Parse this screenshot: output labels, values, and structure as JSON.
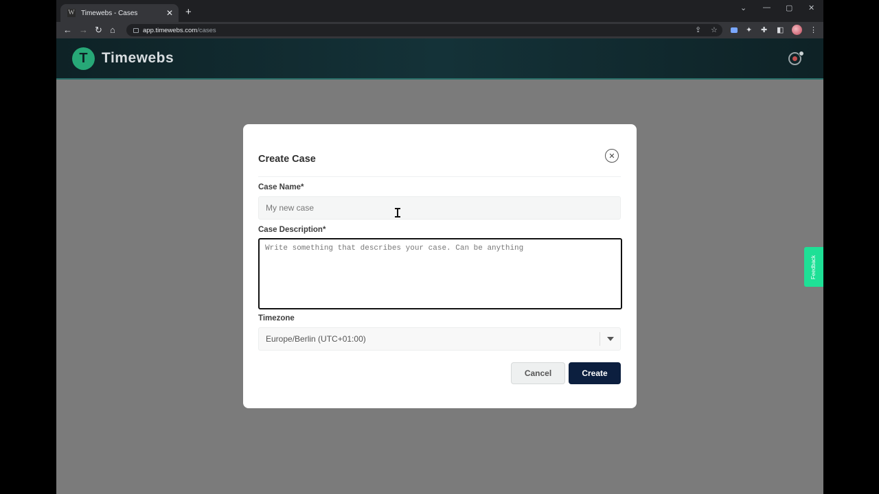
{
  "browser": {
    "tab_title": "Timewebs - Cases",
    "tab_favicon": "W",
    "url_host": "app.timewebs.com",
    "url_path": "/cases"
  },
  "app": {
    "brand": "Timewebs",
    "logo_letter": "T",
    "colors": {
      "header": "#143238",
      "logo": "#27a877",
      "primary_button": "#0c1f3f",
      "feedback_tab": "#1ee096"
    }
  },
  "modal": {
    "title": "Create Case",
    "case_name_label": "Case Name*",
    "case_name_placeholder": "My new case",
    "case_description_label": "Case Description*",
    "case_description_placeholder": "Write something that describes your case. Can be anything",
    "timezone_label": "Timezone",
    "timezone_value": "Europe/Berlin (UTC+01:00)",
    "cancel_label": "Cancel",
    "create_label": "Create"
  },
  "feedback_label": "Feedback"
}
